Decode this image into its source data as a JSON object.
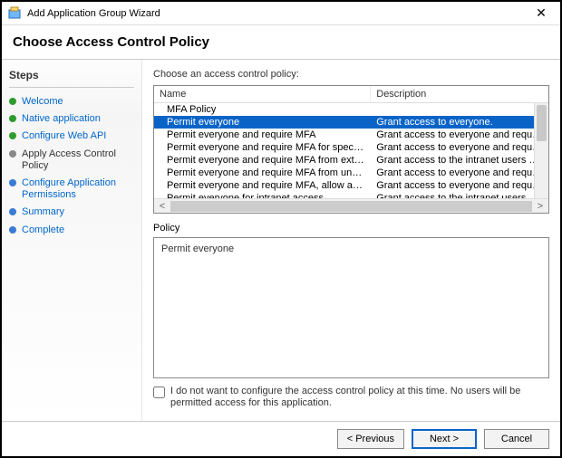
{
  "window": {
    "title": "Add Application Group Wizard"
  },
  "page_title": "Choose Access Control Policy",
  "steps_header": "Steps",
  "steps": [
    {
      "label": "Welcome",
      "state": "done"
    },
    {
      "label": "Native application",
      "state": "done"
    },
    {
      "label": "Configure Web API",
      "state": "done"
    },
    {
      "label": "Apply Access Control Policy",
      "state": "current"
    },
    {
      "label": "Configure Application Permissions",
      "state": "todo"
    },
    {
      "label": "Summary",
      "state": "todo"
    },
    {
      "label": "Complete",
      "state": "todo"
    }
  ],
  "choose_label": "Choose an access control policy:",
  "columns": {
    "name": "Name",
    "description": "Description"
  },
  "policies": [
    {
      "name": "MFA Policy",
      "desc": ""
    },
    {
      "name": "Permit everyone",
      "desc": "Grant access to everyone.",
      "selected": true
    },
    {
      "name": "Permit everyone and require MFA",
      "desc": "Grant access to everyone and require MFA f..."
    },
    {
      "name": "Permit everyone and require MFA for specific group",
      "desc": "Grant access to everyone and require MFA f..."
    },
    {
      "name": "Permit everyone and require MFA from extranet access",
      "desc": "Grant access to the intranet users and requir..."
    },
    {
      "name": "Permit everyone and require MFA from unauthenticated ...",
      "desc": "Grant access to everyone and require MFA f..."
    },
    {
      "name": "Permit everyone and require MFA, allow automatic devi...",
      "desc": "Grant access to everyone and require MFA f..."
    },
    {
      "name": "Permit everyone for intranet access",
      "desc": "Grant access to the intranet users."
    }
  ],
  "policy_label": "Policy",
  "policy_text": "Permit everyone",
  "optout_label": "I do not want to configure the access control policy at this time.  No users will be permitted access for this application.",
  "buttons": {
    "previous": "< Previous",
    "next": "Next >",
    "cancel": "Cancel"
  }
}
